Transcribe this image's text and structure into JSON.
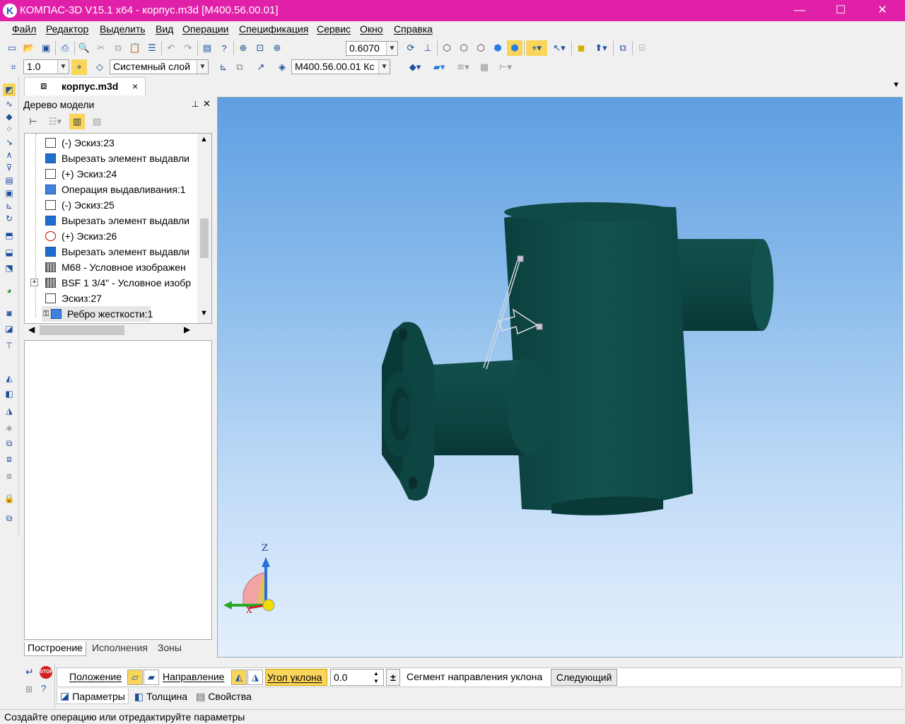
{
  "window": {
    "title": "КОМПАС-3D V15.1 x64 - корпус.m3d [М400.56.00.01]",
    "logo_letter": "K",
    "minimize": "—",
    "maximize": "☐",
    "close": "✕"
  },
  "menu": [
    "Файл",
    "Редактор",
    "Выделить",
    "Вид",
    "Операции",
    "Спецификация",
    "Сервис",
    "Окно",
    "Справка"
  ],
  "toolbar1": {
    "zoom_value": "0.6070"
  },
  "toolbar2": {
    "step_value": "1.0",
    "layer": "Системный слой",
    "designation": "М400.56.00.01 Кс"
  },
  "document_tab": {
    "label": "корпус.m3d",
    "close": "×"
  },
  "tree": {
    "title": "Дерево модели",
    "pin": "⊥",
    "close": "✕",
    "items": [
      {
        "label": "(-) Эскиз:23",
        "icon": "sketch-icon"
      },
      {
        "label": "Вырезать элемент выдавли",
        "icon": "cut-extrude-icon"
      },
      {
        "label": "(+) Эскиз:24",
        "icon": "sketch-icon"
      },
      {
        "label": "Операция выдавливания:1",
        "icon": "extrude-icon"
      },
      {
        "label": "(-) Эскиз:25",
        "icon": "sketch-icon"
      },
      {
        "label": "Вырезать элемент выдавли",
        "icon": "cut-extrude-icon"
      },
      {
        "label": "(+) Эскиз:26",
        "icon": "sketch-error-icon"
      },
      {
        "label": "Вырезать элемент выдавли",
        "icon": "cut-extrude-icon"
      },
      {
        "label": "М68 - Условное изображен",
        "icon": "thread-icon"
      },
      {
        "label": "BSF 1 3/4\" - Условное изобр",
        "icon": "thread-icon"
      },
      {
        "label": "Эскиз:27",
        "icon": "sketch-icon"
      },
      {
        "label": "Ребро жесткости:1",
        "icon": "rib-icon"
      }
    ],
    "expander": "+",
    "tabs": [
      "Построение",
      "Исполнения",
      "Зоны"
    ]
  },
  "axis_labels": {
    "z": "Z",
    "x": "X"
  },
  "params": {
    "position_label": "Положение",
    "direction_label": "Направление",
    "draft_angle_label": "Угол уклона",
    "draft_angle_value": "0.0",
    "segment_label": "Сегмент направления уклона",
    "next_button": "Следующий",
    "tabs": [
      "Параметры",
      "Толщина",
      "Свойства"
    ]
  },
  "status": "Создайте операцию или отредактируйте параметры",
  "colors": {
    "title_bg": "#e020a8",
    "model": "#0f4d4a",
    "accent": "#1d4e9e"
  }
}
